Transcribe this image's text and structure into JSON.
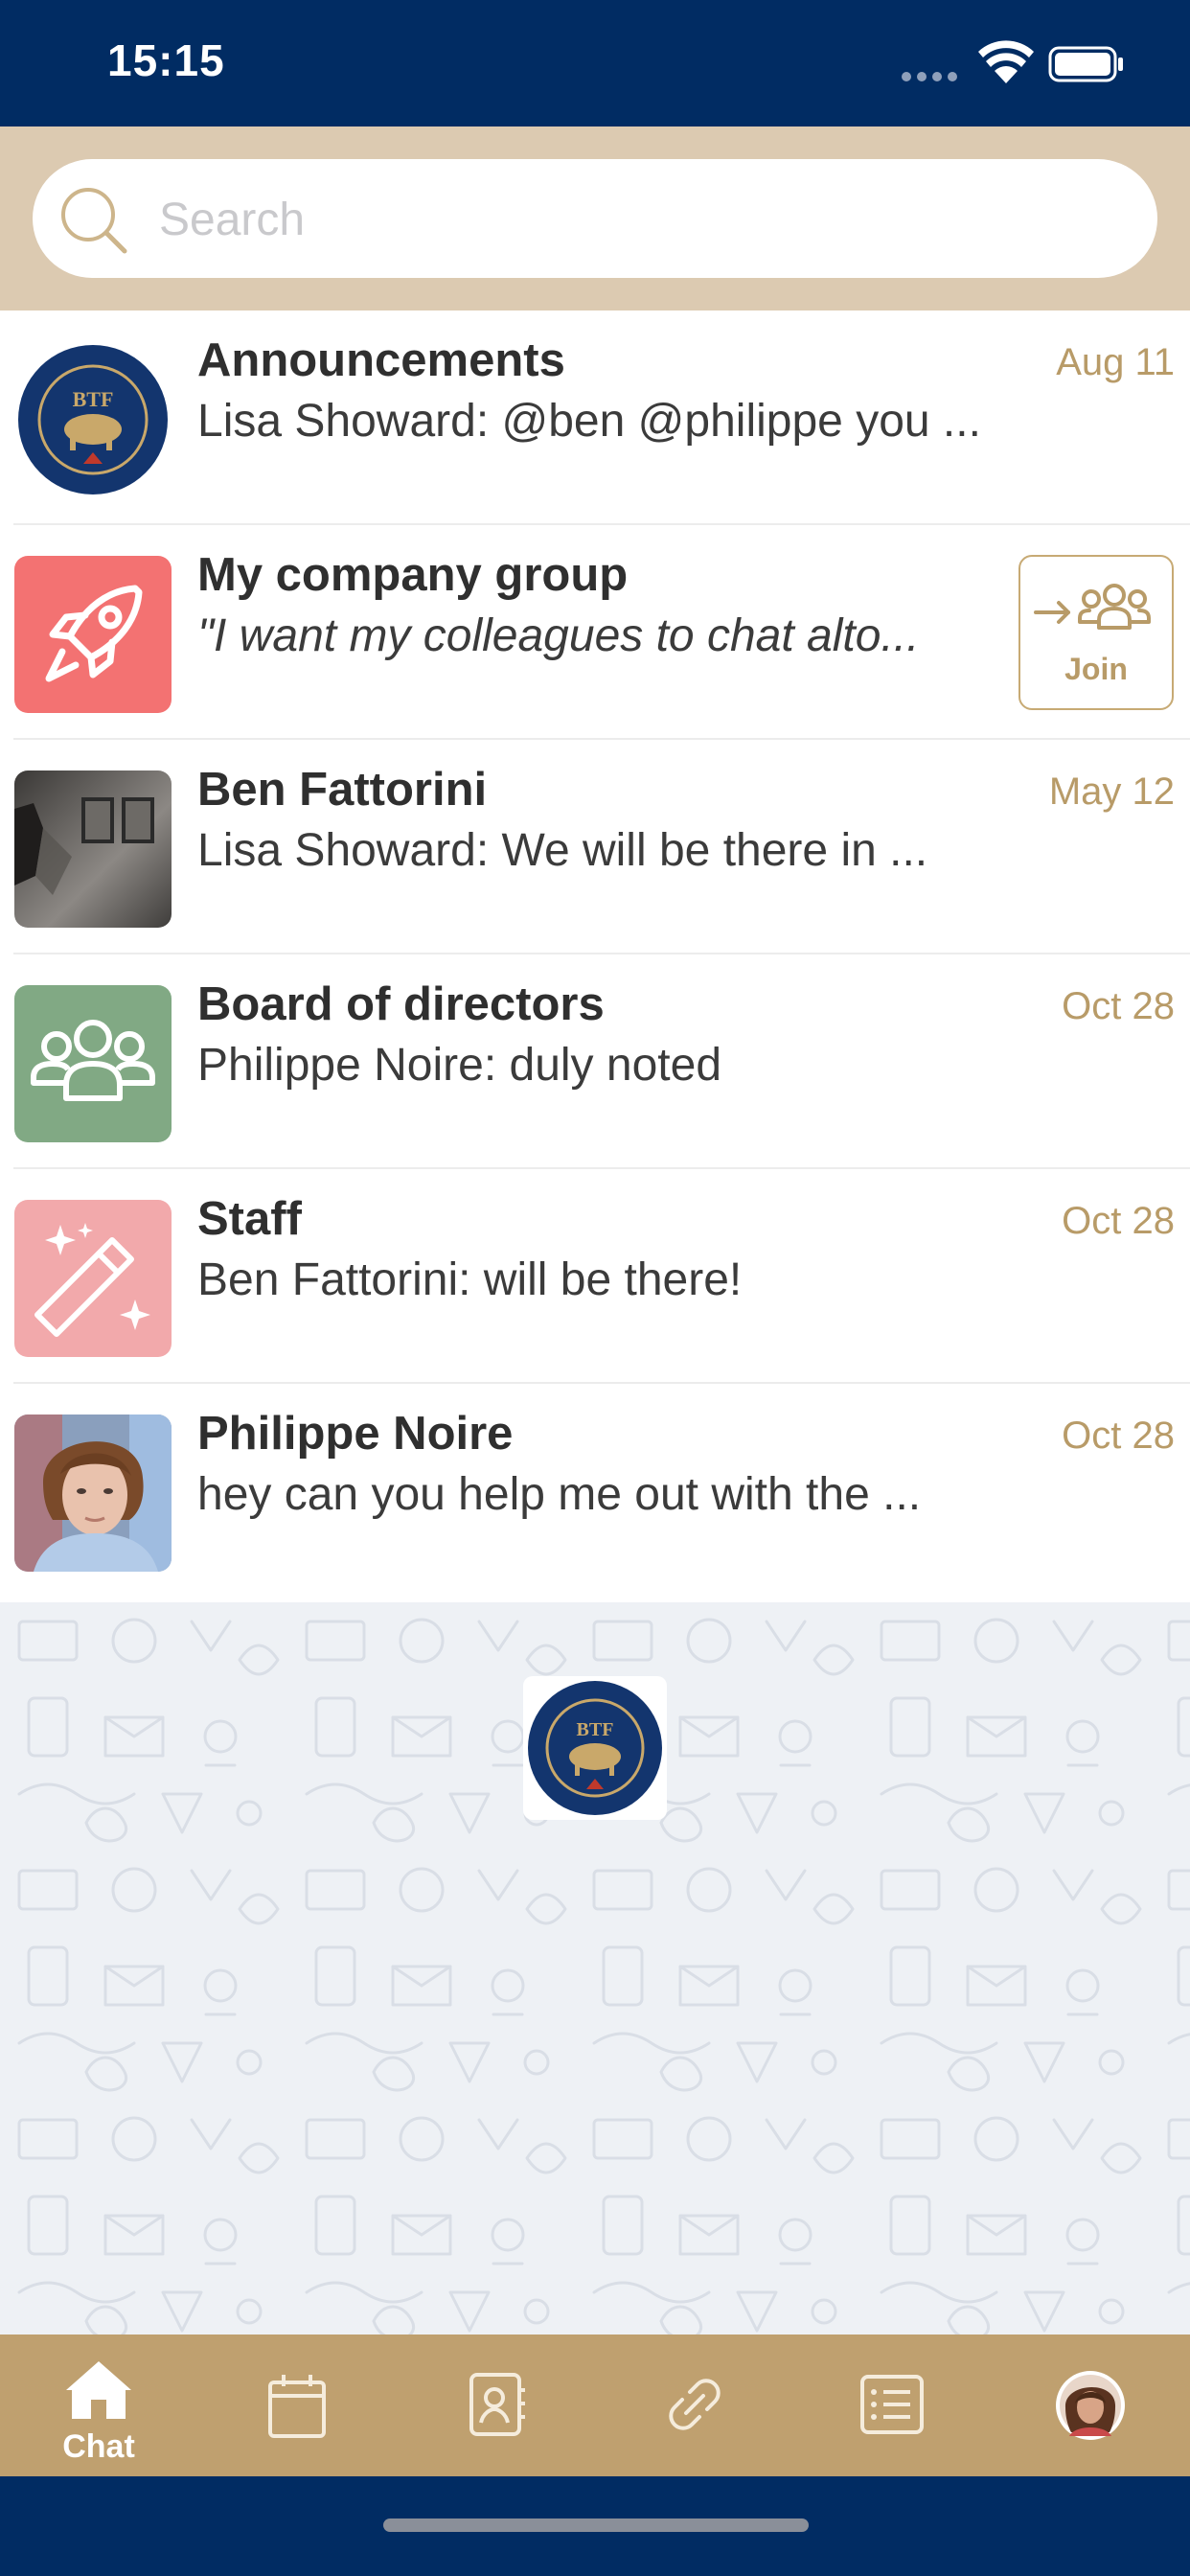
{
  "status_bar": {
    "time": "15:15"
  },
  "search": {
    "placeholder": "Search",
    "value": ""
  },
  "chats": [
    {
      "name": "Announcements",
      "preview": "Lisa Showard: @ben @philippe you ...",
      "date": "Aug 11",
      "avatar": "btf-logo"
    },
    {
      "name": "My company group",
      "preview": "\"I want my colleagues to chat alto...",
      "date": "",
      "avatar": "rocket-icon",
      "join_label": "Join"
    },
    {
      "name": "Ben Fattorini",
      "preview": "Lisa Showard: We will be there in ...",
      "date": "May 12",
      "avatar": "photo"
    },
    {
      "name": "Board of directors",
      "preview": "Philippe Noire: duly noted",
      "date": "Oct 28",
      "avatar": "group-icon"
    },
    {
      "name": "Staff",
      "preview": "Ben Fattorini: will be there!",
      "date": "Oct 28",
      "avatar": "magic-wand-icon"
    },
    {
      "name": "Philippe Noire",
      "preview": "hey can you help me out with the ...",
      "date": "Oct 28",
      "avatar": "photo"
    }
  ],
  "logo": {
    "text": "BTF",
    "ring_text": "BUFFALO TEACHERS FEDERATION"
  },
  "tabs": [
    {
      "icon": "home-icon",
      "label": "Chat",
      "active": true
    },
    {
      "icon": "calendar-icon",
      "label": ""
    },
    {
      "icon": "contacts-icon",
      "label": ""
    },
    {
      "icon": "link-icon",
      "label": ""
    },
    {
      "icon": "list-icon",
      "label": ""
    },
    {
      "icon": "profile-avatar",
      "label": ""
    }
  ],
  "colors": {
    "navy": "#012c63",
    "beige": "#dccab1",
    "tab_gold": "#bfa06f",
    "accent_gold": "#b89b68",
    "coral": "#f37272",
    "green": "#81a984",
    "pink": "#f2a9ab"
  }
}
